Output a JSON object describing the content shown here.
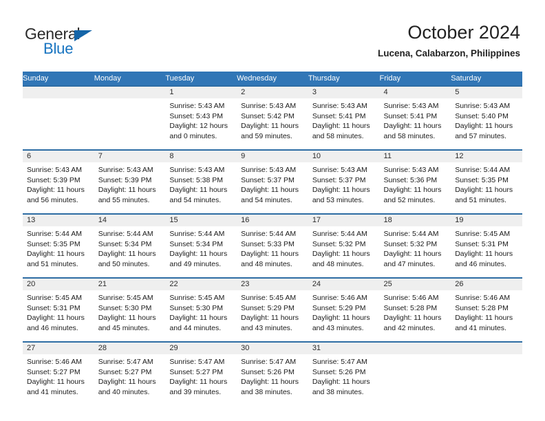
{
  "brand": {
    "name_top": "General",
    "name_bottom": "Blue",
    "accent_color": "#1673c0"
  },
  "header": {
    "month_title": "October 2024",
    "location": "Lucena, Calabarzon, Philippines"
  },
  "theme": {
    "header_row_bg": "#3176b6",
    "row_divider": "#2e6da4",
    "day_band_bg": "#efefef"
  },
  "calendar": {
    "weekday_headers": [
      "Sunday",
      "Monday",
      "Tuesday",
      "Wednesday",
      "Thursday",
      "Friday",
      "Saturday"
    ],
    "weeks": [
      [
        {
          "day": "",
          "sunrise": "",
          "sunset": "",
          "daylight": "",
          "empty": true
        },
        {
          "day": "",
          "sunrise": "",
          "sunset": "",
          "daylight": "",
          "empty": true
        },
        {
          "day": "1",
          "sunrise": "Sunrise: 5:43 AM",
          "sunset": "Sunset: 5:43 PM",
          "daylight": "Daylight: 12 hours and 0 minutes."
        },
        {
          "day": "2",
          "sunrise": "Sunrise: 5:43 AM",
          "sunset": "Sunset: 5:42 PM",
          "daylight": "Daylight: 11 hours and 59 minutes."
        },
        {
          "day": "3",
          "sunrise": "Sunrise: 5:43 AM",
          "sunset": "Sunset: 5:41 PM",
          "daylight": "Daylight: 11 hours and 58 minutes."
        },
        {
          "day": "4",
          "sunrise": "Sunrise: 5:43 AM",
          "sunset": "Sunset: 5:41 PM",
          "daylight": "Daylight: 11 hours and 58 minutes."
        },
        {
          "day": "5",
          "sunrise": "Sunrise: 5:43 AM",
          "sunset": "Sunset: 5:40 PM",
          "daylight": "Daylight: 11 hours and 57 minutes."
        }
      ],
      [
        {
          "day": "6",
          "sunrise": "Sunrise: 5:43 AM",
          "sunset": "Sunset: 5:39 PM",
          "daylight": "Daylight: 11 hours and 56 minutes."
        },
        {
          "day": "7",
          "sunrise": "Sunrise: 5:43 AM",
          "sunset": "Sunset: 5:39 PM",
          "daylight": "Daylight: 11 hours and 55 minutes."
        },
        {
          "day": "8",
          "sunrise": "Sunrise: 5:43 AM",
          "sunset": "Sunset: 5:38 PM",
          "daylight": "Daylight: 11 hours and 54 minutes."
        },
        {
          "day": "9",
          "sunrise": "Sunrise: 5:43 AM",
          "sunset": "Sunset: 5:37 PM",
          "daylight": "Daylight: 11 hours and 54 minutes."
        },
        {
          "day": "10",
          "sunrise": "Sunrise: 5:43 AM",
          "sunset": "Sunset: 5:37 PM",
          "daylight": "Daylight: 11 hours and 53 minutes."
        },
        {
          "day": "11",
          "sunrise": "Sunrise: 5:43 AM",
          "sunset": "Sunset: 5:36 PM",
          "daylight": "Daylight: 11 hours and 52 minutes."
        },
        {
          "day": "12",
          "sunrise": "Sunrise: 5:44 AM",
          "sunset": "Sunset: 5:35 PM",
          "daylight": "Daylight: 11 hours and 51 minutes."
        }
      ],
      [
        {
          "day": "13",
          "sunrise": "Sunrise: 5:44 AM",
          "sunset": "Sunset: 5:35 PM",
          "daylight": "Daylight: 11 hours and 51 minutes."
        },
        {
          "day": "14",
          "sunrise": "Sunrise: 5:44 AM",
          "sunset": "Sunset: 5:34 PM",
          "daylight": "Daylight: 11 hours and 50 minutes."
        },
        {
          "day": "15",
          "sunrise": "Sunrise: 5:44 AM",
          "sunset": "Sunset: 5:34 PM",
          "daylight": "Daylight: 11 hours and 49 minutes."
        },
        {
          "day": "16",
          "sunrise": "Sunrise: 5:44 AM",
          "sunset": "Sunset: 5:33 PM",
          "daylight": "Daylight: 11 hours and 48 minutes."
        },
        {
          "day": "17",
          "sunrise": "Sunrise: 5:44 AM",
          "sunset": "Sunset: 5:32 PM",
          "daylight": "Daylight: 11 hours and 48 minutes."
        },
        {
          "day": "18",
          "sunrise": "Sunrise: 5:44 AM",
          "sunset": "Sunset: 5:32 PM",
          "daylight": "Daylight: 11 hours and 47 minutes."
        },
        {
          "day": "19",
          "sunrise": "Sunrise: 5:45 AM",
          "sunset": "Sunset: 5:31 PM",
          "daylight": "Daylight: 11 hours and 46 minutes."
        }
      ],
      [
        {
          "day": "20",
          "sunrise": "Sunrise: 5:45 AM",
          "sunset": "Sunset: 5:31 PM",
          "daylight": "Daylight: 11 hours and 46 minutes."
        },
        {
          "day": "21",
          "sunrise": "Sunrise: 5:45 AM",
          "sunset": "Sunset: 5:30 PM",
          "daylight": "Daylight: 11 hours and 45 minutes."
        },
        {
          "day": "22",
          "sunrise": "Sunrise: 5:45 AM",
          "sunset": "Sunset: 5:30 PM",
          "daylight": "Daylight: 11 hours and 44 minutes."
        },
        {
          "day": "23",
          "sunrise": "Sunrise: 5:45 AM",
          "sunset": "Sunset: 5:29 PM",
          "daylight": "Daylight: 11 hours and 43 minutes."
        },
        {
          "day": "24",
          "sunrise": "Sunrise: 5:46 AM",
          "sunset": "Sunset: 5:29 PM",
          "daylight": "Daylight: 11 hours and 43 minutes."
        },
        {
          "day": "25",
          "sunrise": "Sunrise: 5:46 AM",
          "sunset": "Sunset: 5:28 PM",
          "daylight": "Daylight: 11 hours and 42 minutes."
        },
        {
          "day": "26",
          "sunrise": "Sunrise: 5:46 AM",
          "sunset": "Sunset: 5:28 PM",
          "daylight": "Daylight: 11 hours and 41 minutes."
        }
      ],
      [
        {
          "day": "27",
          "sunrise": "Sunrise: 5:46 AM",
          "sunset": "Sunset: 5:27 PM",
          "daylight": "Daylight: 11 hours and 41 minutes."
        },
        {
          "day": "28",
          "sunrise": "Sunrise: 5:47 AM",
          "sunset": "Sunset: 5:27 PM",
          "daylight": "Daylight: 11 hours and 40 minutes."
        },
        {
          "day": "29",
          "sunrise": "Sunrise: 5:47 AM",
          "sunset": "Sunset: 5:27 PM",
          "daylight": "Daylight: 11 hours and 39 minutes."
        },
        {
          "day": "30",
          "sunrise": "Sunrise: 5:47 AM",
          "sunset": "Sunset: 5:26 PM",
          "daylight": "Daylight: 11 hours and 38 minutes."
        },
        {
          "day": "31",
          "sunrise": "Sunrise: 5:47 AM",
          "sunset": "Sunset: 5:26 PM",
          "daylight": "Daylight: 11 hours and 38 minutes."
        },
        {
          "day": "",
          "sunrise": "",
          "sunset": "",
          "daylight": "",
          "empty": true
        },
        {
          "day": "",
          "sunrise": "",
          "sunset": "",
          "daylight": "",
          "empty": true
        }
      ]
    ]
  }
}
